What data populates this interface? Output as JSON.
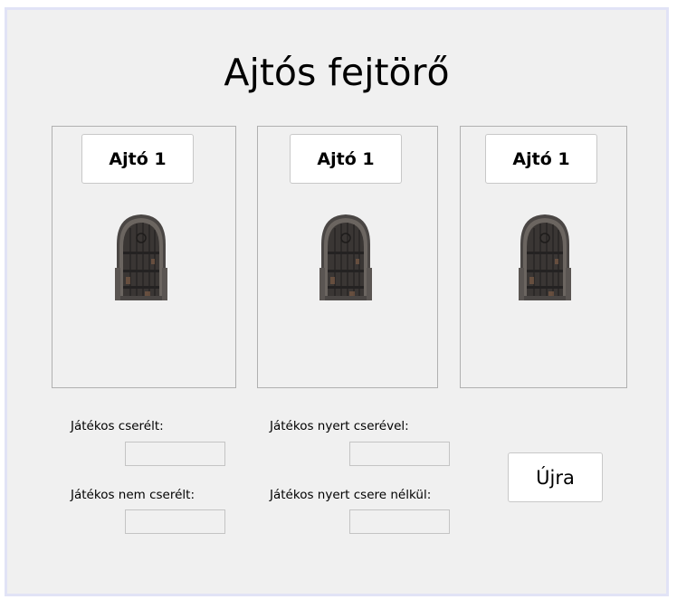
{
  "title": "Ajtós fejtörő",
  "doors": [
    {
      "button_label": "Ajtó 1",
      "icon": "door-icon"
    },
    {
      "button_label": "Ajtó 1",
      "icon": "door-icon"
    },
    {
      "button_label": "Ajtó 1",
      "icon": "door-icon"
    }
  ],
  "stats": {
    "switched_label": "Játékos cserélt:",
    "switched_value": "",
    "not_switched_label": "Játékos nem cserélt:",
    "not_switched_value": "",
    "won_with_switch_label": "Játékos nyert cserével:",
    "won_with_switch_value": "",
    "won_without_switch_label": "Játékos nyert csere nélkül:",
    "won_without_switch_value": ""
  },
  "reset_label": "Újra",
  "colors": {
    "window_bg": "#f0f0f0",
    "window_border": "#e1e3f6",
    "door_wood": "#3a3634"
  }
}
